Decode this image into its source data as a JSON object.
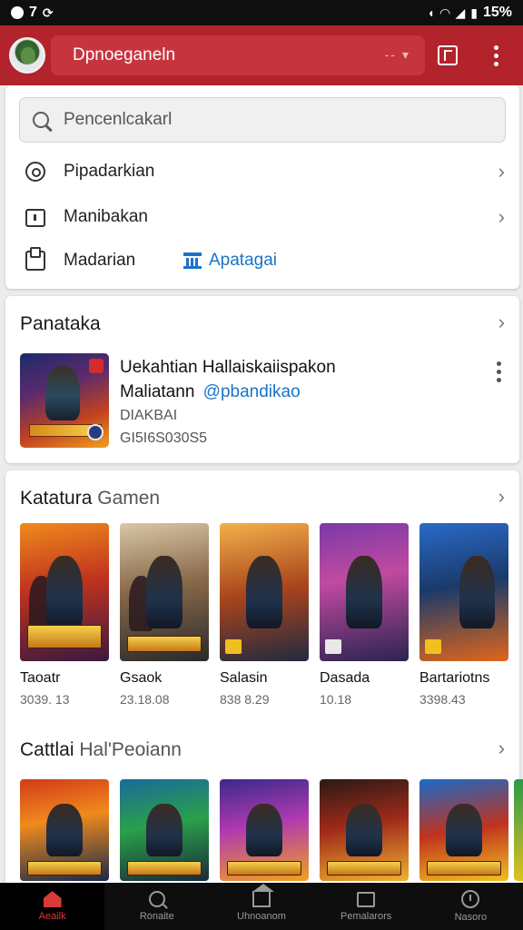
{
  "status_bar": {
    "time": "7",
    "battery": "15%",
    "left_icons": [
      "notification-icon",
      "sync-icon"
    ],
    "right_icons": [
      "mute-icon",
      "wifi-icon",
      "signal-icon",
      "battery-icon"
    ]
  },
  "app_bar": {
    "account_name": "Dpnoeganeln",
    "accent": "#b3232c"
  },
  "search": {
    "placeholder": "Pencenlcakarl"
  },
  "menu": [
    {
      "label": "Pipadarkian",
      "icon": "history-icon"
    },
    {
      "label": "Manibakan",
      "icon": "box-icon"
    },
    {
      "label": "Madarian",
      "icon": "mail-icon",
      "link": "Apatagai"
    }
  ],
  "featured": {
    "title": "Panataka",
    "item_title": "Uekahtian Hallaiskaiispakon",
    "item_subtitle": "Maliatann",
    "item_handle": "@pbandikao",
    "item_meta1": "DIAKBAI",
    "item_meta2": "GI5I6S030S5"
  },
  "section1": {
    "title": "Katatura",
    "title_suffix": "Gamen",
    "games": [
      {
        "name": "Taoatr",
        "count": "3039. 13"
      },
      {
        "name": "Gsaok",
        "count": "23.18.08"
      },
      {
        "name": "Salasin",
        "count": "838 8.29"
      },
      {
        "name": "Dasada",
        "count": "10.18"
      },
      {
        "name": "Bartariotns",
        "count": "3398.43"
      }
    ]
  },
  "section2": {
    "title": "Cattlai",
    "title_suffix": "Hal'Peoiann"
  },
  "bottom_nav": [
    {
      "label": "Aeailk",
      "icon": "home-icon",
      "active": true
    },
    {
      "label": "Ronaite",
      "icon": "search-icon",
      "active": false
    },
    {
      "label": "Uhnoanom",
      "icon": "house-icon",
      "active": false
    },
    {
      "label": "Pemalarors",
      "icon": "chat-icon",
      "active": false
    },
    {
      "label": "Nasoro",
      "icon": "timer-icon",
      "active": false
    }
  ]
}
